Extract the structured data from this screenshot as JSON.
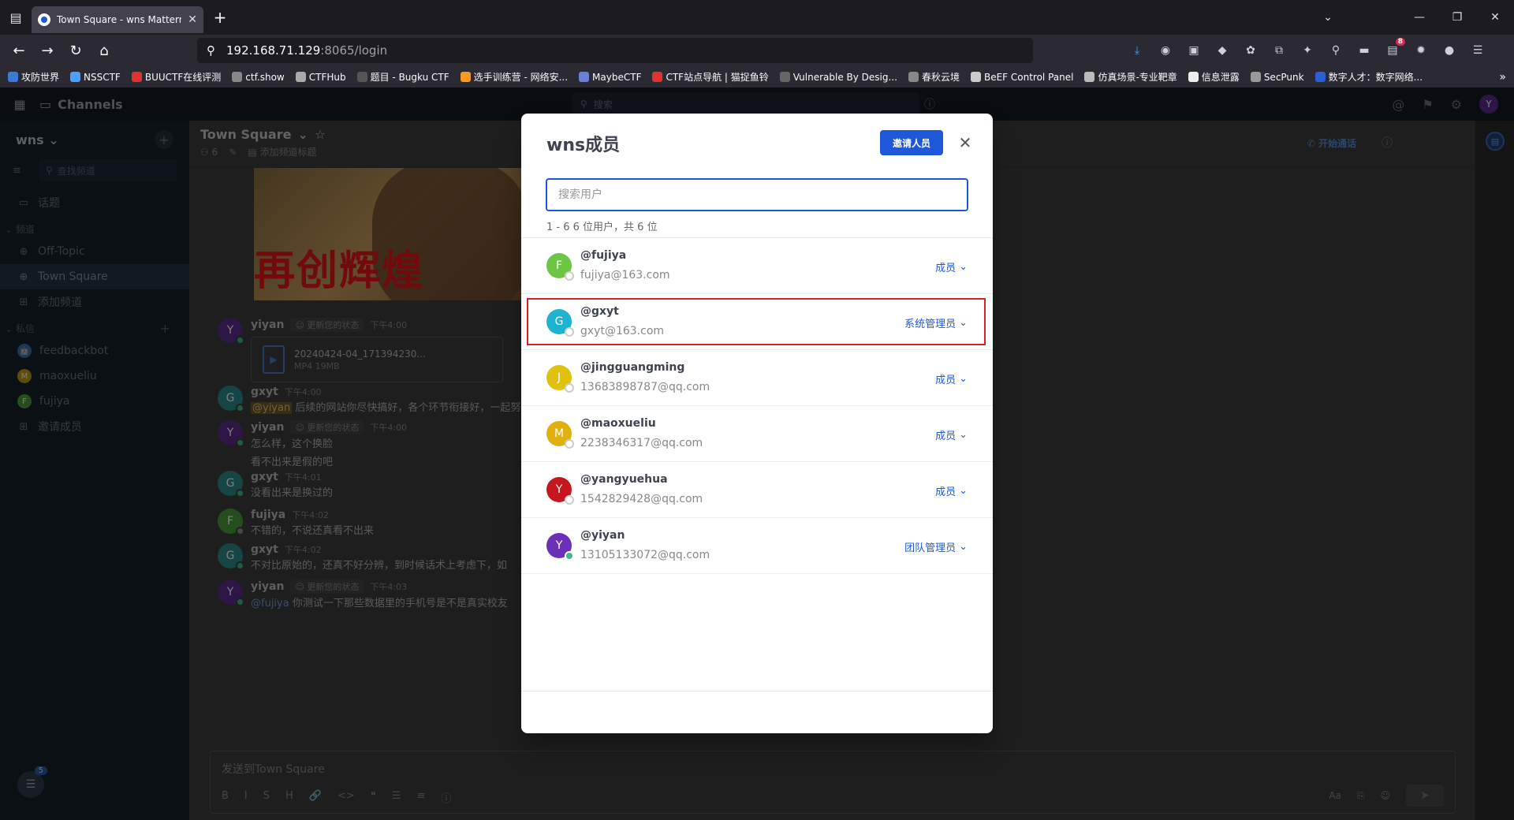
{
  "browser": {
    "tab_title": "Town Square - wns Mattermo",
    "url_host": "192.168.71.129",
    "url_rest": ":8065/login",
    "ext_badge": "8",
    "bookmarks": [
      {
        "label": "攻防世界",
        "color": "#3a7bd5"
      },
      {
        "label": "NSSCTF",
        "color": "#4aa0ff"
      },
      {
        "label": "BUUCTF在线评测",
        "color": "#d33"
      },
      {
        "label": "ctf.show",
        "color": "#888"
      },
      {
        "label": "CTFHub",
        "color": "#aaa"
      },
      {
        "label": "题目 - Bugku CTF",
        "color": "#555"
      },
      {
        "label": "选手训练营 - 网络安...",
        "color": "#f59a23"
      },
      {
        "label": "MaybeCTF",
        "color": "#6a7fd6"
      },
      {
        "label": "CTF站点导航 | 猫捉鱼铃",
        "color": "#d33"
      },
      {
        "label": "Vulnerable By Desig...",
        "color": "#666"
      },
      {
        "label": "春秋云境",
        "color": "#888"
      },
      {
        "label": "BeEF Control Panel",
        "color": "#ccc"
      },
      {
        "label": "仿真场景-专业靶章",
        "color": "#bbb"
      },
      {
        "label": "信息泄露",
        "color": "#eee"
      },
      {
        "label": "SecPunk",
        "color": "#999"
      },
      {
        "label": "数字人才：数字网络...",
        "color": "#2b5fd9"
      }
    ]
  },
  "app": {
    "product": "Channels",
    "search_placeholder": "搜索",
    "user_initial": "Y"
  },
  "sidebar": {
    "team": "wns",
    "find_placeholder": "查找频道",
    "threads": "话题",
    "cat_channels": "频道",
    "channels": [
      {
        "label": "Off-Topic",
        "active": false
      },
      {
        "label": "Town Square",
        "active": true
      }
    ],
    "add_channel": "添加频道",
    "cat_dm": "私信",
    "dms": [
      {
        "label": "feedbackbot",
        "initial": "🤖",
        "color": "#3b6fb6"
      },
      {
        "label": "maoxueliu",
        "initial": "M",
        "color": "#b89a15"
      },
      {
        "label": "fujiya",
        "initial": "F",
        "color": "#4b9a3a"
      }
    ],
    "invite": "邀请成员",
    "notif_count": "5"
  },
  "channel": {
    "name": "Town Square",
    "member_count": "6",
    "add_header": "添加频道标题",
    "start_call": "开始通话"
  },
  "posts": [
    {
      "name": "yiyan",
      "initial": "Y",
      "color": "#5b2a8a",
      "badge": "更新您的状态",
      "time": "下午4:00",
      "file": {
        "name": "20240424-04_171394230...",
        "meta": "MP4 19MB"
      }
    },
    {
      "name": "gxyt",
      "initial": "G",
      "color": "#2a8a8a",
      "time": "下午4:00",
      "mention": "@yiyan",
      "text": " 后续的网站你尽快搞好，各个环节衔接好，一起努"
    },
    {
      "name": "yiyan",
      "initial": "Y",
      "color": "#5b2a8a",
      "badge": "更新您的状态",
      "time": "下午4:00",
      "text": "怎么样，这个换脸",
      "text2": "看不出来是假的吧"
    },
    {
      "name": "gxyt",
      "initial": "G",
      "color": "#2a8a8a",
      "time": "下午4:01",
      "text": "没看出来是换过的"
    },
    {
      "name": "fujiya",
      "initial": "F",
      "color": "#4b9a3a",
      "time": "下午4:02",
      "text": "不错的，不说还真看不出来"
    },
    {
      "name": "gxyt",
      "initial": "G",
      "color": "#2a8a8a",
      "time": "下午4:02",
      "text": "不对比原始的，还真不好分辨，到时候话术上考虑下，如"
    },
    {
      "name": "yiyan",
      "initial": "Y",
      "color": "#5b2a8a",
      "badge": "更新您的状态",
      "time": "下午4:03",
      "mention": "@fujiya",
      "text": " 你测试一下那些数据里的手机号是不是真实校友"
    }
  ],
  "composer": {
    "placeholder": "发送到Town Square",
    "tools": [
      "B",
      "I",
      "S",
      "H",
      "🔗",
      "<>",
      "❝",
      "☰",
      "≡",
      "ⓘ"
    ],
    "format": "Aa"
  },
  "modal": {
    "title": "wns成员",
    "invite_label": "邀请人员",
    "search_placeholder": "搜索用户",
    "count_text": "1 - 6 6 位用户，共 6 位",
    "members": [
      {
        "username": "@fujiya",
        "email": "fujiya@163.com",
        "role": "成员",
        "initial": "F",
        "color": "#6cc644",
        "online": false
      },
      {
        "username": "@gxyt",
        "email": "gxyt@163.com",
        "role": "系统管理员",
        "initial": "G",
        "color": "#1fb3d2",
        "online": false,
        "highlighted": true
      },
      {
        "username": "@jingguangming",
        "email": "13683898787@qq.com",
        "role": "成员",
        "initial": "J",
        "color": "#e0c10f",
        "online": false
      },
      {
        "username": "@maoxueliu",
        "email": "2238346317@qq.com",
        "role": "成员",
        "initial": "M",
        "color": "#e0b00f",
        "online": false
      },
      {
        "username": "@yangyuehua",
        "email": "1542829428@qq.com",
        "role": "成员",
        "initial": "Y",
        "color": "#c5171d",
        "online": false
      },
      {
        "username": "@yiyan",
        "email": "13105133072@qq.com",
        "role": "团队管理员",
        "initial": "Y",
        "color": "#6a31b8",
        "online": true
      }
    ]
  }
}
